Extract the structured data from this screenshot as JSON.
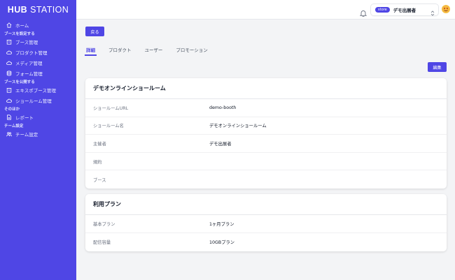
{
  "app": {
    "logo_bold": "HUB",
    "logo_regular": "STATION"
  },
  "sidebar": {
    "home": "ホーム",
    "sections": [
      {
        "label": "ブースを設定する",
        "items": [
          "ブース管理",
          "プロダクト管理",
          "メディア管理",
          "フォーム管理"
        ]
      },
      {
        "label": "ブースを公開する",
        "items": [
          "エキスポブース管理",
          "ショールーム管理"
        ]
      },
      {
        "label": "そのほか",
        "items": [
          "レポート"
        ]
      },
      {
        "label": "チーム設定",
        "items": [
          "チーム設定"
        ]
      }
    ]
  },
  "header": {
    "store_badge": "store",
    "store_name": "デモ出展者",
    "bell_icon": "bell-icon",
    "avatar_icon": "emoji-avatar-icon"
  },
  "actions": {
    "back": "戻る",
    "edit": "編集"
  },
  "tabs": [
    "詳細",
    "プロダクト",
    "ユーザー",
    "プロモーション"
  ],
  "showroom_card": {
    "title": "デモオンラインショールーム",
    "rows": [
      {
        "label": "ショールームURL",
        "value": "demo-booth"
      },
      {
        "label": "ショールーム名",
        "value": "デモオンラインショールーム"
      },
      {
        "label": "主催者",
        "value": "デモ出展者"
      },
      {
        "label": "規約",
        "value": ""
      },
      {
        "label": "ブース",
        "value": ""
      }
    ]
  },
  "plan_card": {
    "title": "利用プラン",
    "rows": [
      {
        "label": "基本プラン",
        "value": "1ヶ月プラン"
      },
      {
        "label": "配信容量",
        "value": "10GBプラン"
      }
    ]
  },
  "colors": {
    "primary": "#4f46e5",
    "background": "#f3f4f6"
  }
}
